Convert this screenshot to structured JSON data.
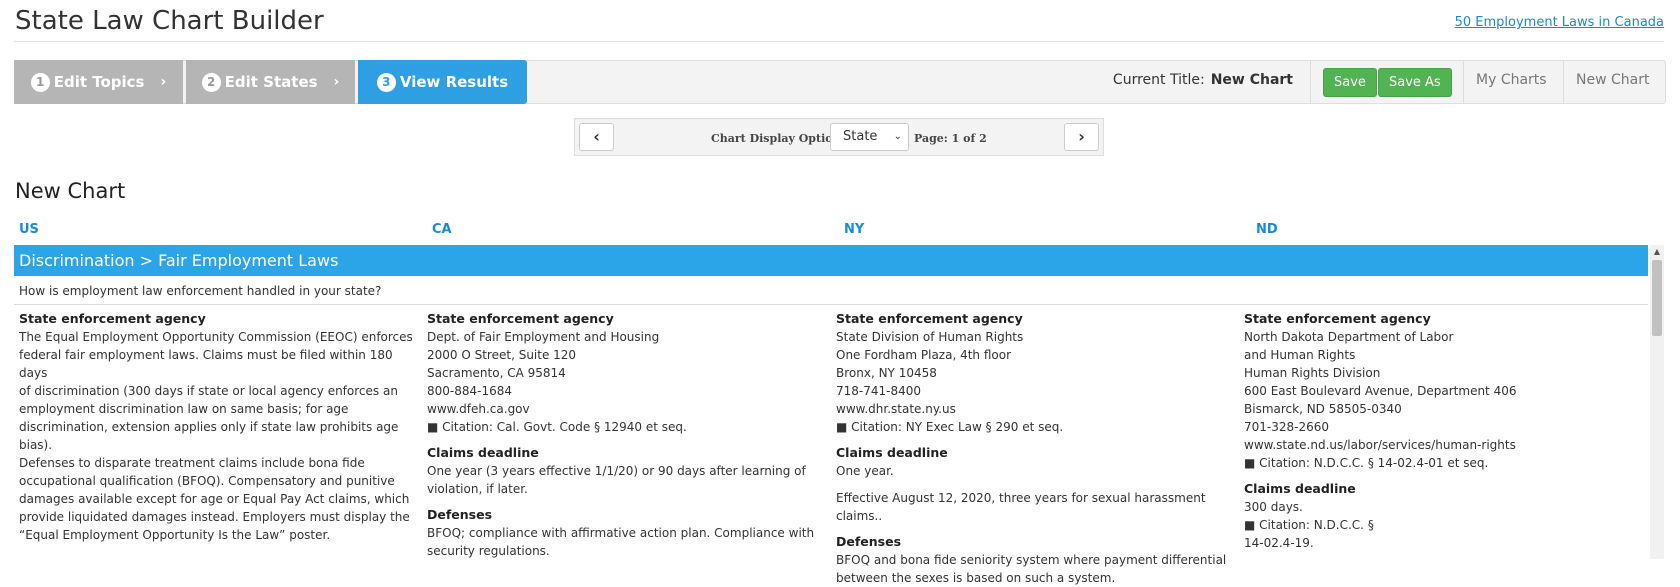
{
  "header": {
    "app_title": "State Law Chart Builder",
    "top_link": "50 Employment Laws in Canada"
  },
  "steps": [
    {
      "num": "1",
      "label": "Edit Topics",
      "chevron": "›"
    },
    {
      "num": "2",
      "label": "Edit States",
      "chevron": "›"
    },
    {
      "num": "3",
      "label": "View Results"
    }
  ],
  "toolbar": {
    "current_title_label": "Current Title:",
    "current_title_value": "New Chart",
    "save_label": "Save",
    "save_as_label": "Save As",
    "my_charts_label": "My Charts",
    "new_chart_label": "New Chart"
  },
  "options": {
    "prev_icon": "chevron-left",
    "next_icon": "chevron-right",
    "display_label": "Chart Display Options:",
    "display_value": "State",
    "page_label": "Page: 1 of 2"
  },
  "chart": {
    "title": "New Chart",
    "columns": [
      "US",
      "CA",
      "NY",
      "ND"
    ],
    "section": "Discrimination > Fair Employment Laws",
    "question": "How is employment law enforcement handled in your state?"
  },
  "cells": {
    "us": {
      "label": "State enforcement agency",
      "lines": [
        "The Equal Employment Opportunity Commission (EEOC) enforces",
        "federal fair employment laws. Claims must be filed within 180 days",
        "of discrimination (300 days if state or local agency enforces an",
        "employment discrimination law on same basis; for age",
        "discrimination, extension applies only if state law prohibits age bias).",
        "Defenses to disparate treatment claims include bona fide",
        "occupational qualification (BFOQ). Compensatory and punitive",
        "damages available except for age or Equal Pay Act claims, which",
        "provide liquidated damages instead. Employers must display the",
        "“Equal Employment Opportunity Is the Law” poster."
      ]
    },
    "ca": {
      "label": "State enforcement agency",
      "lines": [
        "Dept. of Fair Employment and Housing",
        "2000 O Street, Suite 120",
        "Sacramento, CA 95814",
        "800-884-1684",
        "www.dfeh.ca.gov",
        "■ Citation: Cal. Govt. Code § 12940 et seq."
      ],
      "deadline_label": "Claims deadline",
      "deadline_lines": [
        "One year (3 years effective 1/1/20) or 90 days after learning of",
        "violation, if later."
      ],
      "defenses_label": "Defenses",
      "defenses_lines": [
        "BFOQ; compliance with affirmative action plan. Compliance with",
        "security regulations."
      ]
    },
    "ny": {
      "label": "State enforcement agency",
      "lines": [
        "State Division of Human Rights",
        "One Fordham Plaza, 4th floor",
        "Bronx, NY 10458",
        "718-741-8400",
        "www.dhr.state.ny.us",
        "■ Citation: NY Exec Law § 290 et seq."
      ],
      "deadline_label": "Claims deadline",
      "deadline_lines": [
        "One year."
      ],
      "deadline_extra": "Effective August 12, 2020, three years for sexual harassment claims..",
      "defenses_label": "Defenses",
      "defenses_lines": [
        "BFOQ and bona fide seniority system where payment differential",
        "between the sexes is based on such a system."
      ]
    },
    "nd": {
      "label": "State enforcement agency",
      "lines": [
        "North Dakota Department of Labor",
        "and Human Rights",
        "Human Rights Division",
        "600 East Boulevard Avenue, Department 406",
        "Bismarck, ND 58505-0340",
        "701-328-2660",
        "www.state.nd.us/labor/services/human-rights",
        "■ Citation: N.D.C.C. § 14-02.4-01 et seq."
      ],
      "deadline_label": "Claims deadline",
      "deadline_lines": [
        "300 days.",
        "■ Citation: N.D.C.C. §",
        "14-02.4-19."
      ]
    }
  },
  "colors": {
    "accent": "#2ca5e8",
    "link": "#1a8ad3",
    "save_green": "#52b352",
    "step_inactive": "#b5b5b5"
  }
}
